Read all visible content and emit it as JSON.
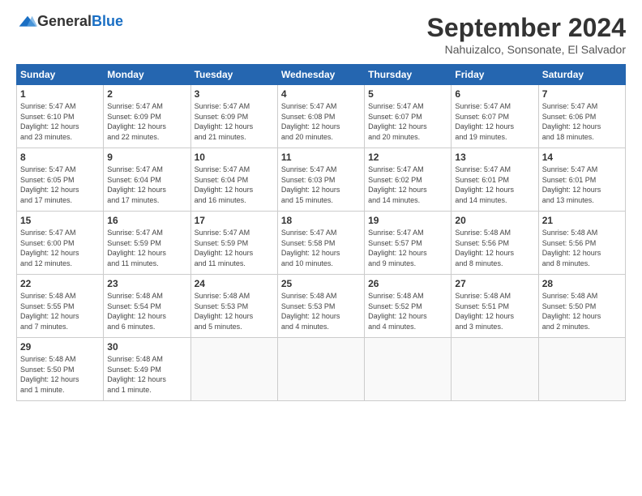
{
  "header": {
    "logo_general": "General",
    "logo_blue": "Blue",
    "month_title": "September 2024",
    "location": "Nahuizalco, Sonsonate, El Salvador"
  },
  "weekdays": [
    "Sunday",
    "Monday",
    "Tuesday",
    "Wednesday",
    "Thursday",
    "Friday",
    "Saturday"
  ],
  "weeks": [
    [
      {
        "day": "1",
        "info": "Sunrise: 5:47 AM\nSunset: 6:10 PM\nDaylight: 12 hours\nand 23 minutes."
      },
      {
        "day": "2",
        "info": "Sunrise: 5:47 AM\nSunset: 6:09 PM\nDaylight: 12 hours\nand 22 minutes."
      },
      {
        "day": "3",
        "info": "Sunrise: 5:47 AM\nSunset: 6:09 PM\nDaylight: 12 hours\nand 21 minutes."
      },
      {
        "day": "4",
        "info": "Sunrise: 5:47 AM\nSunset: 6:08 PM\nDaylight: 12 hours\nand 20 minutes."
      },
      {
        "day": "5",
        "info": "Sunrise: 5:47 AM\nSunset: 6:07 PM\nDaylight: 12 hours\nand 20 minutes."
      },
      {
        "day": "6",
        "info": "Sunrise: 5:47 AM\nSunset: 6:07 PM\nDaylight: 12 hours\nand 19 minutes."
      },
      {
        "day": "7",
        "info": "Sunrise: 5:47 AM\nSunset: 6:06 PM\nDaylight: 12 hours\nand 18 minutes."
      }
    ],
    [
      {
        "day": "8",
        "info": "Sunrise: 5:47 AM\nSunset: 6:05 PM\nDaylight: 12 hours\nand 17 minutes."
      },
      {
        "day": "9",
        "info": "Sunrise: 5:47 AM\nSunset: 6:04 PM\nDaylight: 12 hours\nand 17 minutes."
      },
      {
        "day": "10",
        "info": "Sunrise: 5:47 AM\nSunset: 6:04 PM\nDaylight: 12 hours\nand 16 minutes."
      },
      {
        "day": "11",
        "info": "Sunrise: 5:47 AM\nSunset: 6:03 PM\nDaylight: 12 hours\nand 15 minutes."
      },
      {
        "day": "12",
        "info": "Sunrise: 5:47 AM\nSunset: 6:02 PM\nDaylight: 12 hours\nand 14 minutes."
      },
      {
        "day": "13",
        "info": "Sunrise: 5:47 AM\nSunset: 6:01 PM\nDaylight: 12 hours\nand 14 minutes."
      },
      {
        "day": "14",
        "info": "Sunrise: 5:47 AM\nSunset: 6:01 PM\nDaylight: 12 hours\nand 13 minutes."
      }
    ],
    [
      {
        "day": "15",
        "info": "Sunrise: 5:47 AM\nSunset: 6:00 PM\nDaylight: 12 hours\nand 12 minutes."
      },
      {
        "day": "16",
        "info": "Sunrise: 5:47 AM\nSunset: 5:59 PM\nDaylight: 12 hours\nand 11 minutes."
      },
      {
        "day": "17",
        "info": "Sunrise: 5:47 AM\nSunset: 5:59 PM\nDaylight: 12 hours\nand 11 minutes."
      },
      {
        "day": "18",
        "info": "Sunrise: 5:47 AM\nSunset: 5:58 PM\nDaylight: 12 hours\nand 10 minutes."
      },
      {
        "day": "19",
        "info": "Sunrise: 5:47 AM\nSunset: 5:57 PM\nDaylight: 12 hours\nand 9 minutes."
      },
      {
        "day": "20",
        "info": "Sunrise: 5:48 AM\nSunset: 5:56 PM\nDaylight: 12 hours\nand 8 minutes."
      },
      {
        "day": "21",
        "info": "Sunrise: 5:48 AM\nSunset: 5:56 PM\nDaylight: 12 hours\nand 8 minutes."
      }
    ],
    [
      {
        "day": "22",
        "info": "Sunrise: 5:48 AM\nSunset: 5:55 PM\nDaylight: 12 hours\nand 7 minutes."
      },
      {
        "day": "23",
        "info": "Sunrise: 5:48 AM\nSunset: 5:54 PM\nDaylight: 12 hours\nand 6 minutes."
      },
      {
        "day": "24",
        "info": "Sunrise: 5:48 AM\nSunset: 5:53 PM\nDaylight: 12 hours\nand 5 minutes."
      },
      {
        "day": "25",
        "info": "Sunrise: 5:48 AM\nSunset: 5:53 PM\nDaylight: 12 hours\nand 4 minutes."
      },
      {
        "day": "26",
        "info": "Sunrise: 5:48 AM\nSunset: 5:52 PM\nDaylight: 12 hours\nand 4 minutes."
      },
      {
        "day": "27",
        "info": "Sunrise: 5:48 AM\nSunset: 5:51 PM\nDaylight: 12 hours\nand 3 minutes."
      },
      {
        "day": "28",
        "info": "Sunrise: 5:48 AM\nSunset: 5:50 PM\nDaylight: 12 hours\nand 2 minutes."
      }
    ],
    [
      {
        "day": "29",
        "info": "Sunrise: 5:48 AM\nSunset: 5:50 PM\nDaylight: 12 hours\nand 1 minute."
      },
      {
        "day": "30",
        "info": "Sunrise: 5:48 AM\nSunset: 5:49 PM\nDaylight: 12 hours\nand 1 minute."
      },
      {
        "day": "",
        "info": ""
      },
      {
        "day": "",
        "info": ""
      },
      {
        "day": "",
        "info": ""
      },
      {
        "day": "",
        "info": ""
      },
      {
        "day": "",
        "info": ""
      }
    ]
  ]
}
